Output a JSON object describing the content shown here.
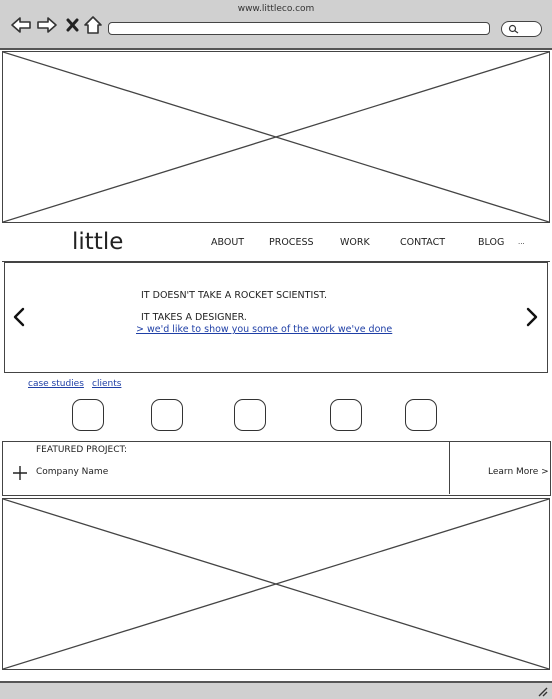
{
  "window": {
    "url": "www.littleco.com"
  },
  "icons": {
    "back": "back-arrow-icon",
    "forward": "forward-arrow-icon",
    "stop": "close-icon",
    "home": "home-icon",
    "search": "search-icon",
    "carousel_prev": "chevron-left-icon",
    "carousel_next": "chevron-right-icon",
    "expand": "plus-icon",
    "resize": "resize-grip-icon"
  },
  "header": {
    "logo": "little",
    "nav": [
      "ABOUT",
      "PROCESS",
      "WORK",
      "CONTACT",
      "BLOG",
      "..."
    ]
  },
  "hero": {
    "line1": "IT DOESN'T TAKE A ROCKET SCIENTIST.",
    "line2": "IT TAKES A DESIGNER.",
    "link": "> we'd like to show you some of the work we've done"
  },
  "tabs": [
    "case studies",
    "clients"
  ],
  "featured": {
    "label": "FEATURED PROJECT:",
    "company": "Company Name",
    "learn_more": "Learn More >"
  },
  "colors": {
    "chrome": "#d0d0d0",
    "link": "#1f3fa6",
    "stroke": "#444444"
  }
}
